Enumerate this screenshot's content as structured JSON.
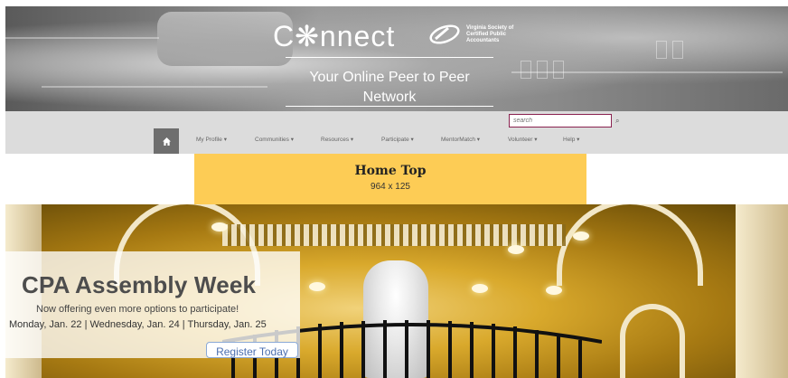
{
  "header": {
    "logo_text": "C❋nnect",
    "org_name": "Virginia Society of Certified Public Accountants",
    "tagline_line1": "Your Online Peer to Peer",
    "tagline_line2": "Network"
  },
  "search": {
    "placeholder": "search"
  },
  "nav": {
    "home_icon": "home-icon",
    "items": [
      "My Profile ▾",
      "Communities ▾",
      "Resources ▾",
      "Participate ▾",
      "MentorMatch ▾",
      "Volunteer ▾",
      "Help ▾"
    ]
  },
  "ad": {
    "title": "Home Top",
    "size": "964 x 125"
  },
  "promo": {
    "title": "CPA Assembly Week",
    "subtitle": "Now offering even more options to participate!",
    "dates": "Monday, Jan. 22  |  Wednesday, Jan. 24  | Thursday, Jan. 25",
    "button": "Register Today"
  },
  "colors": {
    "nav_bg": "#dcdcdc",
    "ad_bg": "#fdcc55",
    "search_border": "#8a2250",
    "button_text": "#4b6fb0"
  }
}
